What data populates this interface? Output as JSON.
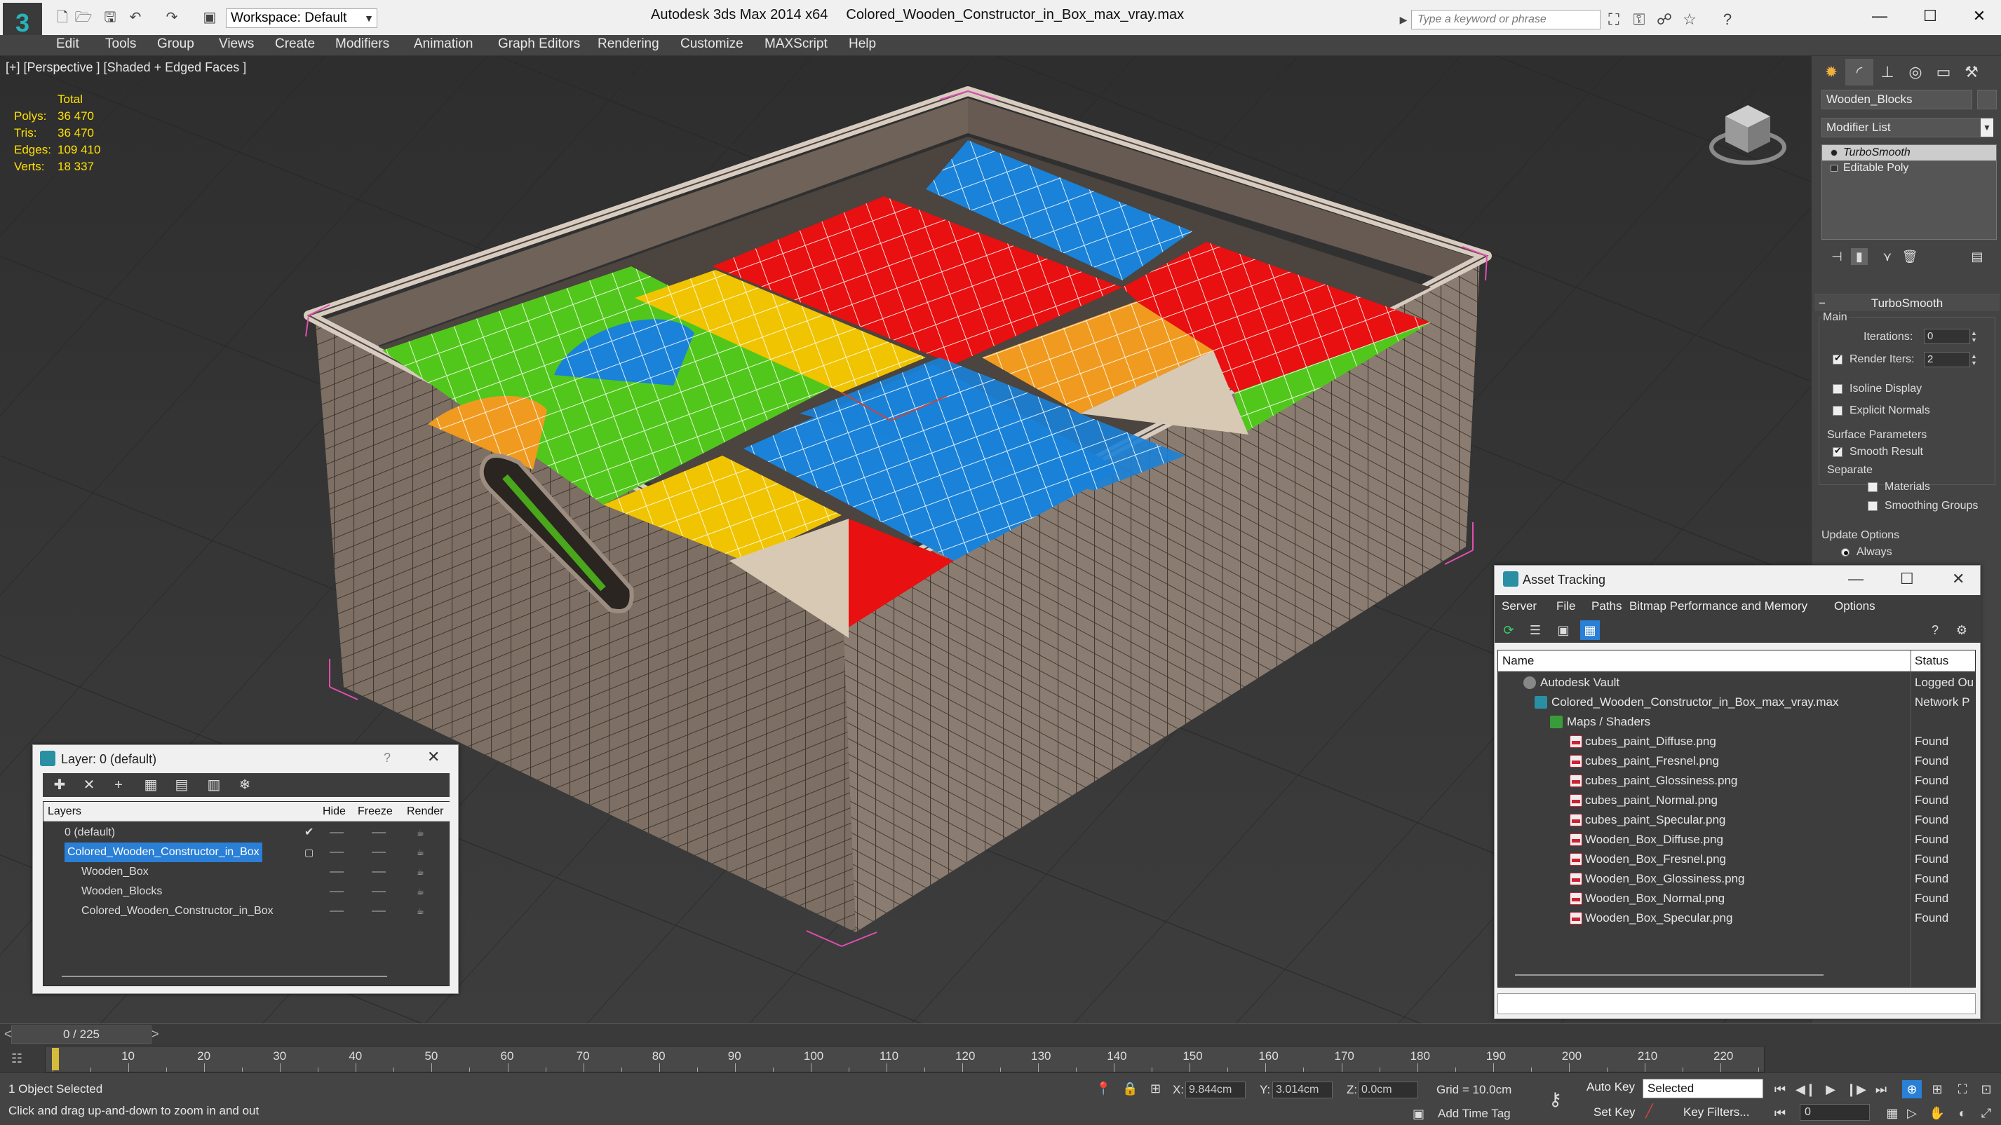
{
  "titlebar": {
    "app_title": "Autodesk 3ds Max  2014 x64",
    "file_name": "Colored_Wooden_Constructor_in_Box_max_vray.max",
    "workspace_label": "Workspace: Default",
    "search_placeholder": "Type a keyword or phrase",
    "window_buttons": [
      "—",
      "☐",
      "✕"
    ]
  },
  "menu": [
    "Edit",
    "Tools",
    "Group",
    "Views",
    "Create",
    "Modifiers",
    "Animation",
    "Graph Editors",
    "Rendering",
    "Customize",
    "MAXScript",
    "Help"
  ],
  "viewport": {
    "label": "[+] [Perspective ] [Shaded + Edged Faces ]",
    "stats_header": "Total",
    "stats": [
      {
        "key": "Polys:",
        "value": "36 470"
      },
      {
        "key": "Tris:",
        "value": "36 470"
      },
      {
        "key": "Edges:",
        "value": "109 410"
      },
      {
        "key": "Verts:",
        "value": "18 337"
      }
    ]
  },
  "command_panel": {
    "object_name": "Wooden_Blocks",
    "modifier_list": "Modifier List",
    "stack": [
      "TurboSmooth",
      "Editable Poly"
    ],
    "rollout_title": "TurboSmooth",
    "main_label": "Main",
    "iterations_label": "Iterations:",
    "iterations_value": "0",
    "render_iters_label": "Render Iters:",
    "render_iters_value": "2",
    "render_iters_checked": true,
    "isoline_label": "Isoline Display",
    "explicit_label": "Explicit Normals",
    "surface_label": "Surface Parameters",
    "smooth_label": "Smooth Result",
    "separate_label": "Separate",
    "materials_label": "Materials",
    "smoothing_label": "Smoothing Groups",
    "update_label": "Update Options",
    "always_label": "Always"
  },
  "layer_dialog": {
    "title": "Layer: 0 (default)",
    "help": "?",
    "close": "✕",
    "columns": [
      "Layers",
      "Hide",
      "Freeze",
      "Render"
    ],
    "rows": [
      {
        "name": "0 (default)"
      },
      {
        "name": "Colored_Wooden_Constructor_in_Box"
      },
      {
        "name": "Wooden_Box"
      },
      {
        "name": "Wooden_Blocks"
      },
      {
        "name": "Colored_Wooden_Constructor_in_Box"
      }
    ]
  },
  "asset_dialog": {
    "title": "Asset Tracking",
    "menu": [
      "Server",
      "File",
      "Paths",
      "Bitmap Performance and Memory",
      "Options"
    ],
    "columns": [
      "Name",
      "Status"
    ],
    "rows": [
      {
        "name": "Autodesk Vault",
        "status": "Logged Ou"
      },
      {
        "name": "Colored_Wooden_Constructor_in_Box_max_vray.max",
        "status": "Network P"
      },
      {
        "name": "Maps / Shaders",
        "status": ""
      },
      {
        "name": "cubes_paint_Diffuse.png",
        "status": "Found"
      },
      {
        "name": "cubes_paint_Fresnel.png",
        "status": "Found"
      },
      {
        "name": "cubes_paint_Glossiness.png",
        "status": "Found"
      },
      {
        "name": "cubes_paint_Normal.png",
        "status": "Found"
      },
      {
        "name": "cubes_paint_Specular.png",
        "status": "Found"
      },
      {
        "name": "Wooden_Box_Diffuse.png",
        "status": "Found"
      },
      {
        "name": "Wooden_Box_Fresnel.png",
        "status": "Found"
      },
      {
        "name": "Wooden_Box_Glossiness.png",
        "status": "Found"
      },
      {
        "name": "Wooden_Box_Normal.png",
        "status": "Found"
      },
      {
        "name": "Wooden_Box_Specular.png",
        "status": "Found"
      }
    ]
  },
  "timeline": {
    "slider_label": "0 / 225",
    "ticks": [
      "10",
      "20",
      "30",
      "40",
      "50",
      "60",
      "70",
      "80",
      "90",
      "100",
      "110",
      "120",
      "130",
      "140",
      "150",
      "160",
      "170",
      "180",
      "190",
      "200",
      "210",
      "220"
    ]
  },
  "status": {
    "selection": "1 Object Selected",
    "prompt": "Click and drag up-and-down to zoom in and out",
    "x_label": "X:",
    "x_value": "9.844cm",
    "y_label": "Y:",
    "y_value": "3.014cm",
    "z_label": "Z:",
    "z_value": "0.0cm",
    "grid": "Grid = 10.0cm",
    "add_time_tag": "Add Time Tag",
    "auto_key": "Auto Key",
    "set_key": "Set Key",
    "selected_option": "Selected",
    "key_filters": "Key Filters...",
    "frame_value": "0"
  }
}
